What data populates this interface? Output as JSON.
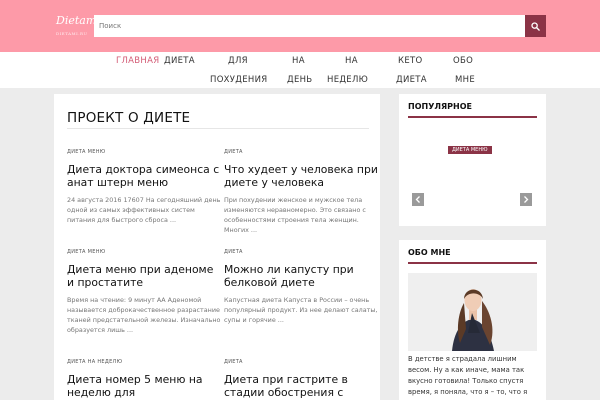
{
  "header": {
    "logo": "Dietami",
    "logo_sub": "DIETAMI.RU",
    "search_placeholder": "Поиск",
    "search_icon": "search-icon"
  },
  "nav": [
    {
      "label": "ГЛАВНАЯ",
      "active": true
    },
    {
      "label": "ДИЕТА"
    },
    {
      "label": "ДЛЯ"
    },
    {
      "label": "ПОХУДЕНИЯ"
    },
    {
      "label": "НА"
    },
    {
      "label": "ДЕНЬ"
    },
    {
      "label": "НА"
    },
    {
      "label": "НЕДЕЛЮ"
    },
    {
      "label": "КЕТО"
    },
    {
      "label": "ДИЕТА"
    },
    {
      "label": "ОБО"
    },
    {
      "label": "МНЕ"
    }
  ],
  "main": {
    "title": "ПРОЕКТ О ДИЕТЕ",
    "posts": [
      {
        "category": "ДИЕТА МЕНЮ",
        "title": "Диета доктора симеонса с анат штерн меню",
        "excerpt": "24 августа 2016 17607 На сегодняшний день одной из самых эффективных систем питания для быстрого сброса ..."
      },
      {
        "category": "ДИЕТА",
        "title": "Что худеет у человека при диете у человека",
        "excerpt": "При похудении женское и мужское тела изменяются неравномерно. Это связано с особенностями строения тела женщин. Многих ..."
      },
      {
        "category": "ДИЕТА МЕНЮ",
        "title": "Диета меню при аденоме и простатите",
        "excerpt": "Время на чтение: 9 минут АА Аденомой называется доброкачественное разрастание тканей предстательной железы. Изначально образуется лишь ..."
      },
      {
        "category": "ДИЕТА",
        "title": "Можно ли капусту при белковой диете",
        "excerpt": "Капустная диета Капуста в России – очень популярный продукт. Из нее делают салаты, супы и горячие ..."
      },
      {
        "category": "ДИЕТА НА НЕДЕЛЮ",
        "title": "Диета номер 5 меню на неделю для",
        "excerpt": ""
      },
      {
        "category": "ДИЕТА",
        "title": "Диета при гастрите в стадии обострения с",
        "excerpt": ""
      }
    ]
  },
  "sidebar": {
    "popular_title": "ПОПУЛЯРНОЕ",
    "popular_badge": "ДИЕТА МЕНЮ",
    "about_title": "ОБО МНЕ",
    "about_text": "В детстве я страдала лишним весом. Ну а как иначе, мама так вкусно готовила! Только спустя время, я поняла, что я – то, что я ем. Это"
  },
  "colors": {
    "header_bg": "#fd9aa8",
    "accent": "#8b3346",
    "nav_active": "#d35b75"
  }
}
